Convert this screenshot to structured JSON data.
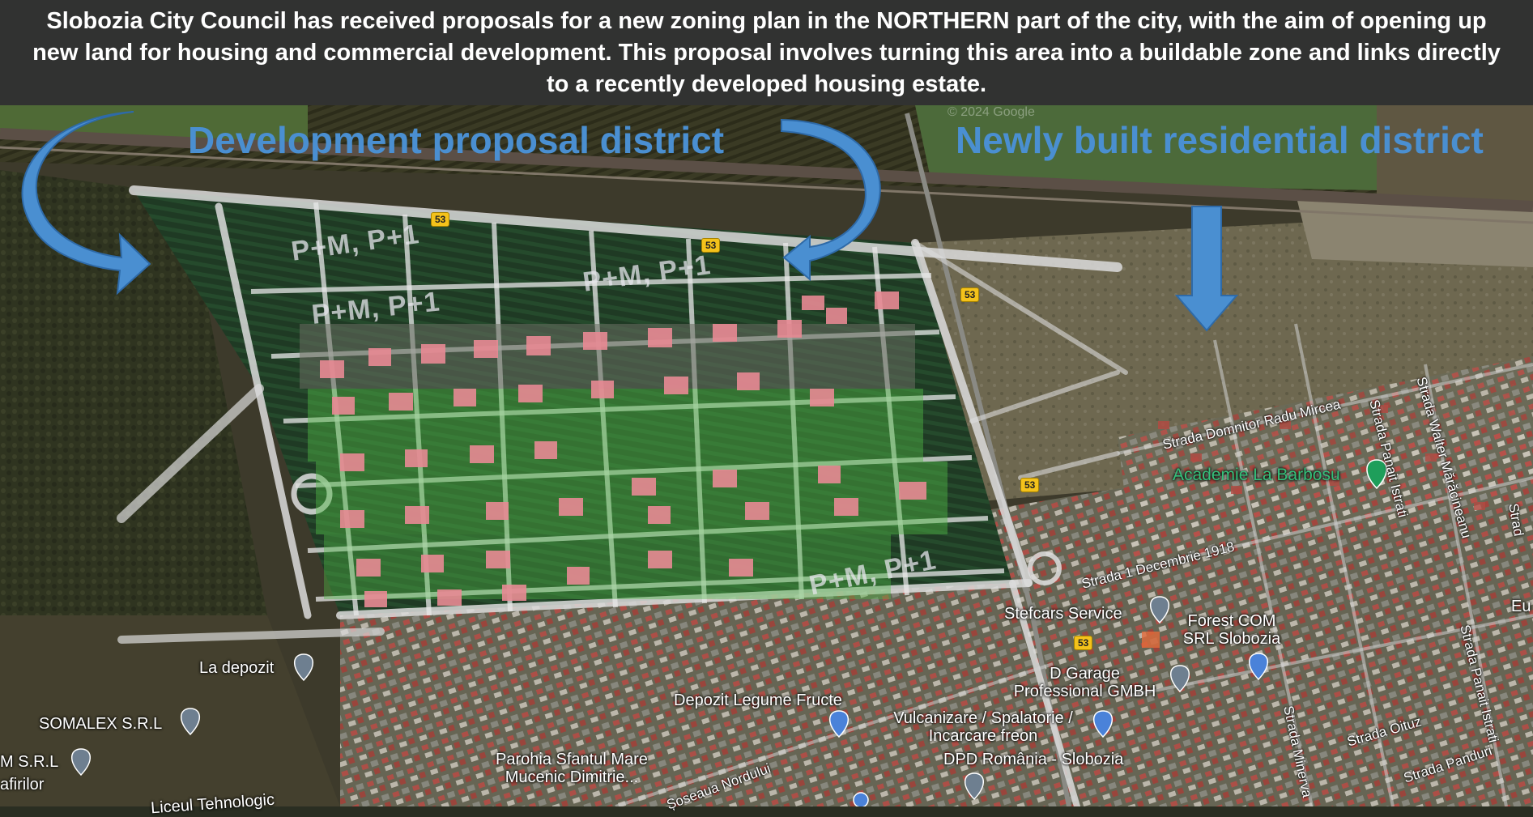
{
  "banner": {
    "text": "Slobozia City Council has received proposals for a new zoning plan in the NORTHERN part of the city, with the aim of opening up new land for housing and commercial development. This proposal involves turning this area into a buildable zone and links directly to a recently developed housing estate."
  },
  "districts": {
    "left_label": "Development proposal district",
    "right_label": "Newly built residential district"
  },
  "zoning_labels": [
    "P+M, P+1",
    "P+M, P+1",
    "P+M, P+1",
    "P+M, P+1"
  ],
  "road_shields": [
    "53",
    "53",
    "53",
    "53",
    "53"
  ],
  "watermark": "© 2024 Google",
  "streets": {
    "domnitor": "Strada Domnitor Radu Mircea",
    "decembrie": "Strada 1 Decembrie 1918",
    "panait1": "Strada Panait Istrati",
    "walter": "Strada Walter Mărăcineanu",
    "panait2": "Strada Panait Istrati",
    "minerva": "Strada Minerva",
    "oituz": "Strada Oituz",
    "panduri": "Strada Panduri",
    "soseaua": "Șoseaua Nordului",
    "strada_partial": "Strad"
  },
  "pois": {
    "academie": "Academie La Barbosu",
    "stefcars": "Stefcars Service",
    "forest": "Forest COM SRL Slobozia",
    "garage": "D Garage Professional GMBH",
    "vulcanizare": "Vulcanizare / Spalatorie / Incarcare freon",
    "dpd": "DPD România - Slobozia",
    "depozit_legume": "Depozit Legume Fructe",
    "parohia": "Parohia Sfantul Mare Mucenic Dimitrie...",
    "la_depozit": "La depozit",
    "somalex": "SOMALEX S.R.L",
    "msrl": "M S.R.L",
    "afirilor": "afirilor",
    "eu": "Eu",
    "liceul": "Liceul Tehnologic"
  },
  "colors": {
    "arrow": "#4a8fd1",
    "label": "#4a8fd1",
    "banner_bg": "#303232",
    "building_roof": "#e88a94",
    "green_space": "#4fb845",
    "poi_green": "#35c07a"
  }
}
